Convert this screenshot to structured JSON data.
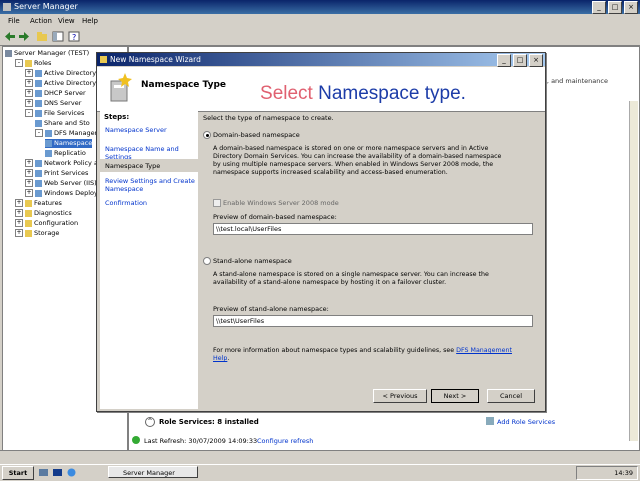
{
  "app": {
    "title": "Server Manager"
  },
  "menu": [
    "File",
    "Action",
    "View",
    "Help"
  ],
  "tree": [
    {
      "label": "Server Manager (TEST)",
      "indent": 0,
      "exp": ""
    },
    {
      "label": "Roles",
      "indent": 1,
      "exp": "-"
    },
    {
      "label": "Active Directory C",
      "indent": 2,
      "exp": "+"
    },
    {
      "label": "Active Directory D",
      "indent": 2,
      "exp": "+"
    },
    {
      "label": "DHCP Server",
      "indent": 2,
      "exp": "+"
    },
    {
      "label": "DNS Server",
      "indent": 2,
      "exp": "+"
    },
    {
      "label": "File Services",
      "indent": 2,
      "exp": "-"
    },
    {
      "label": "Share and Sto",
      "indent": 3,
      "exp": ""
    },
    {
      "label": "DFS Manager",
      "indent": 3,
      "exp": "-"
    },
    {
      "label": "Namespace",
      "indent": 4,
      "exp": ""
    },
    {
      "label": "Replicatio",
      "indent": 4,
      "exp": ""
    },
    {
      "label": "Network Policy an",
      "indent": 2,
      "exp": "+"
    },
    {
      "label": "Print Services",
      "indent": 2,
      "exp": "+"
    },
    {
      "label": "Web Server (IIS)",
      "indent": 2,
      "exp": "+"
    },
    {
      "label": "Windows Deployme",
      "indent": 2,
      "exp": "+"
    },
    {
      "label": "Features",
      "indent": 1,
      "exp": "+"
    },
    {
      "label": "Diagnostics",
      "indent": 1,
      "exp": "+"
    },
    {
      "label": "Configuration",
      "indent": 1,
      "exp": "+"
    },
    {
      "label": "Storage",
      "indent": 1,
      "exp": "+"
    }
  ],
  "content": {
    "right_text": "ig, and maintenance",
    "role_services": "Role Services: 8 installed",
    "add_role_services": "Add Role Services",
    "last_refresh": "Last Refresh: 30/07/2009 14:09:33",
    "configure_refresh": "Configure refresh"
  },
  "wizard": {
    "title": "New Namespace Wizard",
    "header": "Namespace Type",
    "steps_heading": "Steps:",
    "steps": [
      "Namespace Server",
      "Namespace Name and Settings",
      "Namespace Type",
      "Review Settings and Create Namespace",
      "Confirmation"
    ],
    "instruction": "Select the type of namespace to create.",
    "domain_option": "Domain-based namespace",
    "domain_desc": "A domain-based namespace is stored on one or more namespace servers and in Active Directory Domain Services. You can increase the availability of a domain-based namespace by using multiple namespace servers. When enabled in Windows Server 2008 mode, the namespace supports increased scalability and access-based enumeration.",
    "w2008_option": "Enable Windows Server 2008 mode",
    "domain_preview_label": "Preview of domain-based namespace:",
    "domain_preview": "\\\\test.local\\UserFiles",
    "standalone_option": "Stand-alone namespace",
    "standalone_desc": "A stand-alone namespace is stored on a single namespace server. You can increase the availability of a stand-alone namespace by hosting it on a failover cluster.",
    "standalone_preview_label": "Preview of stand-alone namespace:",
    "standalone_preview": "\\\\test\\UserFiles",
    "more_info": "For more information about namespace types and scalability guidelines, see",
    "more_info_link": "DFS Management Help",
    "btn_prev": "< Previous",
    "btn_next": "Next >",
    "btn_cancel": "Cancel"
  },
  "overlay": {
    "word1": "Select",
    "word2": "Namespace type."
  },
  "taskbar": {
    "start": "Start",
    "task": "Server Manager",
    "clock": "14:39"
  },
  "colors": {
    "overlay_red": "#e06070",
    "overlay_blue": "#1c3ca8",
    "link": "#0033cc",
    "title_bar": "#0a246a"
  }
}
